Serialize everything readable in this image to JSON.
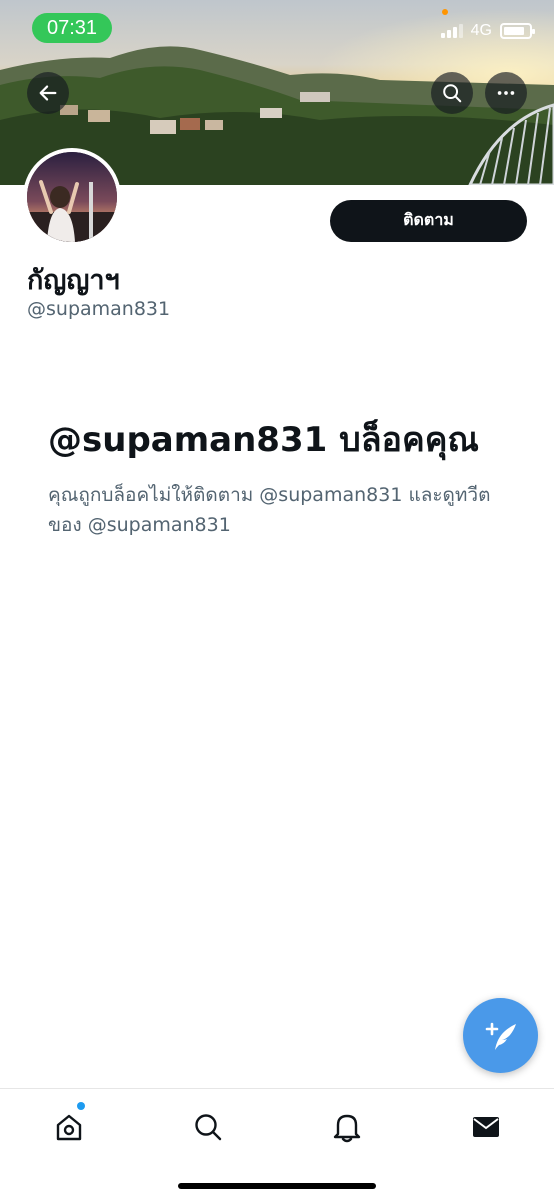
{
  "status_bar": {
    "time": "07:31",
    "network": "4G",
    "time_pill_color": "#34c759"
  },
  "banner": {
    "icons": {
      "back": "arrow-left-icon",
      "search": "search-icon",
      "more": "more-horizontal-icon"
    }
  },
  "profile": {
    "display_name": "กัญญาฯ",
    "handle": "@supaman831",
    "follow_label": "ติดตาม"
  },
  "blocked": {
    "title": "@supaman831 บล็อคคุณ",
    "description": "คุณถูกบล็อคไม่ให้ติดตาม @supaman831 และดูทวีตของ @supaman831"
  },
  "fab": {
    "icon": "compose-tweet-icon",
    "color": "#4a99e9"
  },
  "bottom_nav": {
    "items": [
      {
        "icon": "home-icon"
      },
      {
        "icon": "search-icon"
      },
      {
        "icon": "notifications-bell-icon"
      },
      {
        "icon": "messages-envelope-icon"
      }
    ],
    "accent": "#1d9bf0"
  }
}
